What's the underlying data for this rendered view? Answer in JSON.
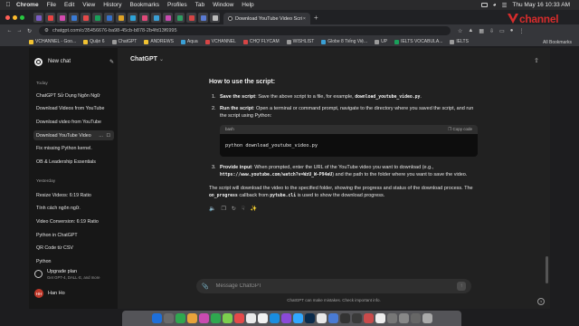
{
  "menubar": {
    "items": [
      "Chrome",
      "File",
      "Edit",
      "View",
      "History",
      "Bookmarks",
      "Profiles",
      "Tab",
      "Window",
      "Help"
    ],
    "datetime": "Thu May 16  10:33 AM"
  },
  "browser": {
    "tab_title": "Download YouTube Video Scri",
    "url": "chatgpt.com/c/35456676-ba98-45cb-b878-2b4fd13f6995",
    "tab_favicon_colors": [
      "#7b5cc5",
      "#e94343",
      "#d44ab0",
      "#3a7bd5",
      "#e64a4a",
      "#1a9f5a",
      "#3570c9",
      "#e0a325",
      "#2ea3d8",
      "#e04a7a",
      "#3aa0d6",
      "#c94bb0",
      "#2f9e63",
      "#d64545",
      "#5a7bd3",
      "#bbbbbb"
    ]
  },
  "bookmarks": [
    {
      "label": "VCHANNEL - Goo...",
      "color": "#f1c232"
    },
    {
      "label": "Quận 6",
      "color": "#f1c232"
    },
    {
      "label": "ChatGPT",
      "color": "#9a9a9a"
    },
    {
      "label": "ANDREWS",
      "color": "#f1c232"
    },
    {
      "label": "Aqua",
      "color": "#3aa0d6"
    },
    {
      "label": "VCHANNEL",
      "color": "#d64545"
    },
    {
      "label": "CHỢ FLYCAM",
      "color": "#d64545"
    },
    {
      "label": "WISHLIST",
      "color": "#9a9a9a"
    },
    {
      "label": "Globe 8 Tiếng Việ...",
      "color": "#3aa0d6"
    },
    {
      "label": "UP",
      "color": "#9a9a9a"
    },
    {
      "label": "IELTS VOCABULA...",
      "color": "#1a9f5a"
    },
    {
      "label": "IELTS",
      "color": "#9a9a9a"
    }
  ],
  "bookmarks_all": "All Bookmarks",
  "brand": {
    "text": "channel"
  },
  "sidebar": {
    "new_chat": "New chat",
    "sections": [
      {
        "label": "Today",
        "items": [
          "ChatGPT Sử Dụng Ngôn Ngữ",
          "Download Videos from YouTube",
          "Download video from YouTube",
          "Download YouTube Video",
          "Fix missing Python kernel.",
          "OB & Leadership Essentials"
        ]
      },
      {
        "label": "Yesterday",
        "items": [
          "Resize Videos: 6:19 Ratio",
          "Tính cách ngôn ngữ.",
          "Video Conversion: 6:19 Ratio",
          "Python in ChatGPT",
          "QR Code từ CSV",
          "Python"
        ]
      }
    ],
    "upgrade_title": "Upgrade plan",
    "upgrade_sub": "Get GPT-4, DALL·E, and more",
    "user_initials": "HH",
    "user_name": "Han Ho"
  },
  "chat": {
    "model": "ChatGPT",
    "heading": "How to use the script:",
    "step1_num": "1.",
    "step1_bold": "Save the script",
    "step1_text": ": Save the above script to a file, for example,",
    "step1_code": "download_youtube_video.py",
    "step2_num": "2.",
    "step2_bold": "Run the script",
    "step2_text": ": Open a terminal or command prompt, navigate to the directory where you saved the script, and run the script using Python:",
    "code_lang": "bash",
    "copy_label": "Copy code",
    "code_line": "python download_youtube_video.py",
    "step3_num": "3.",
    "step3_bold": "Provide input",
    "step3_text_a": ": When prompted, enter the URL of the YouTube video you want to download (e.g.,",
    "step3_code": "https://www.youtube.com/watch?v=WzU_W-P94eU",
    "step3_text_b": ") and the path to the folder where you want to save the video.",
    "para_a": "The script will download the video to the specified folder, showing the progress and status of the download process. The",
    "para_code1": "on_progress",
    "para_b": "callback from",
    "para_code2": "pytube.cli",
    "para_c": "is used to show the download progress.",
    "input_placeholder": "Message ChatGPT",
    "disclaimer": "ChatGPT can make mistakes. Check important info."
  },
  "dock_colors": [
    "#1e6fd9",
    "#6b6b6b",
    "#2fa84f",
    "#e8a33b",
    "#c94bb0",
    "#2fa84f",
    "#7ccf4e",
    "#e64a4a",
    "#eaeaea",
    "#f2f2f2",
    "#1a8de0",
    "#8a4ad8",
    "#31a8ff",
    "#0a2a4a",
    "#e8e8e8",
    "#4a7bd3",
    "#333333",
    "#3a3a3a",
    "#c94b4b",
    "#eeeeee",
    "#777777",
    "#888888",
    "#666666",
    "#aaaaaa"
  ]
}
